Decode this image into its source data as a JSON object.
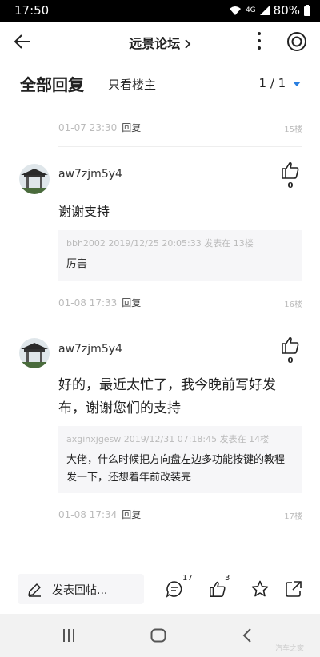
{
  "status": {
    "time": "17:50",
    "network": "4G",
    "battery": "80%"
  },
  "header": {
    "title": "远景论坛 "
  },
  "tabs": {
    "all": "全部回复",
    "owner_only": "只看楼主",
    "page": "1 / 1"
  },
  "posts": [
    {
      "date": "01-07 23:30",
      "reply": "回复",
      "floor": "15楼"
    },
    {
      "user": "aw7zjm5y4",
      "likes": "0",
      "text": "谢谢支持",
      "quote_head": "bbh2002 2019/12/25 20:05:33 发表在 13楼",
      "quote_body": "厉害",
      "date": "01-08 17:33",
      "reply": "回复",
      "floor": "16楼"
    },
    {
      "user": "aw7zjm5y4",
      "likes": "0",
      "text": "好的，最近太忙了，我今晚前写好发布，谢谢您们的支持",
      "quote_head": "axginxjgesw 2019/12/31 07:18:45 发表在 14楼",
      "quote_body": "大佬，什么时候把方向盘左边多功能按键的教程发一下，还想着年前改装完",
      "date": "01-08 17:34",
      "reply": "回复",
      "floor": "17楼"
    }
  ],
  "bottom": {
    "compose": "发表回帖...",
    "comment_count": "17",
    "like_count": "3"
  },
  "watermark": "汽车之家"
}
